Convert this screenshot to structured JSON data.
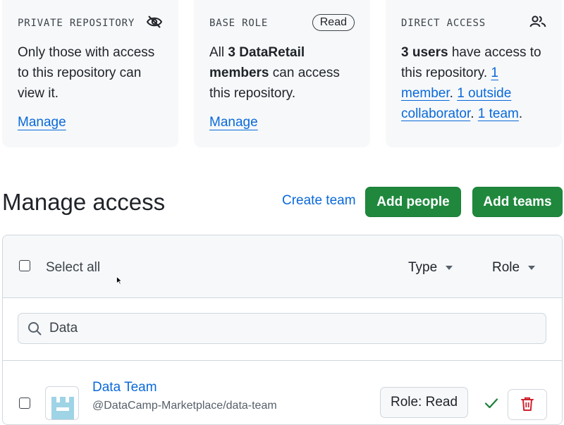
{
  "cards": {
    "private": {
      "title": "PRIVATE REPOSITORY",
      "body": "Only those with access to this repository can view it.",
      "link": "Manage"
    },
    "base": {
      "title": "BASE ROLE",
      "pill": "Read",
      "body_pre": "All ",
      "body_bold": "3 DataRetail members",
      "body_post": " can access this repository.",
      "link": "Manage"
    },
    "direct": {
      "title": "DIRECT ACCESS",
      "bold": "3 users",
      "text1": " have access to this repository. ",
      "link1": "1 member",
      "sep1": ". ",
      "link2": "1 outside collaborator",
      "sep2": ". ",
      "link3": "1 team",
      "end": "."
    }
  },
  "header": {
    "title": "Manage access",
    "create_team": "Create team",
    "add_people": "Add people",
    "add_teams": "Add teams"
  },
  "table": {
    "select_all": "Select all",
    "type_filter": "Type",
    "role_filter": "Role",
    "search_value": "Data",
    "rows": [
      {
        "name": "Data Team",
        "path": "@DataCamp-Marketplace/data-team",
        "role": "Role: Read"
      }
    ]
  },
  "colors": {
    "accent": "#0969da",
    "primary_button": "#1f883d",
    "danger": "#cf222e",
    "success": "#1a7f37"
  },
  "icons": [
    "eye-closed-icon",
    "people-icon",
    "search-icon",
    "check-icon",
    "trash-icon",
    "caret-down-icon"
  ]
}
